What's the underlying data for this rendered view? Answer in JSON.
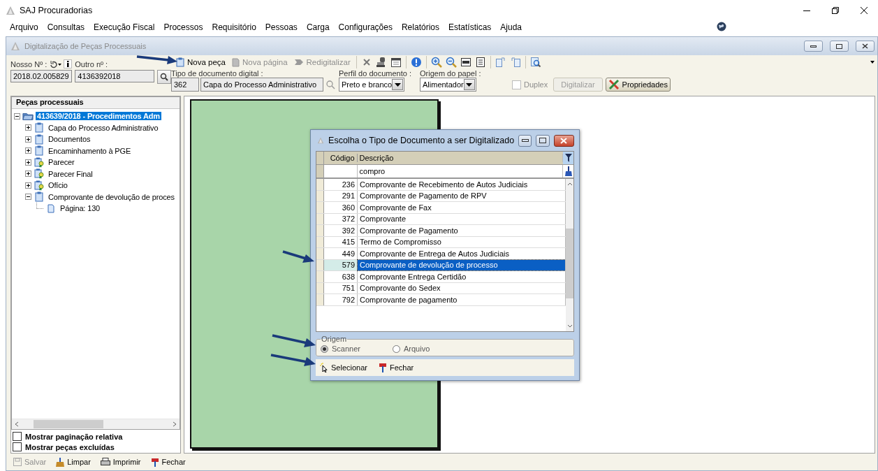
{
  "app_title": "SAJ Procuradorias",
  "menu": [
    "Arquivo",
    "Consultas",
    "Execução Fiscal",
    "Processos",
    "Requisitório",
    "Pessoas",
    "Carga",
    "Configurações",
    "Relatórios",
    "Estatísticas",
    "Ajuda"
  ],
  "window": {
    "title": "Digitalização de Peças Processuais"
  },
  "nosso_numero": {
    "label": "Nosso Nº :",
    "value": "2018.02.005829"
  },
  "outro_numero": {
    "label": "Outro nº :",
    "value": "4136392018"
  },
  "toolbar": [
    {
      "label": "Nova peça",
      "disabled": false
    },
    {
      "label": "Nova página",
      "disabled": true
    },
    {
      "label": "Redigitalizar",
      "disabled": true
    }
  ],
  "tipo_documento": {
    "label": "Tipo de documento digital :",
    "code": "362",
    "value": "Capa do Processo Administrativo"
  },
  "perfil": {
    "label": "Perfil do documento :",
    "value": "Preto e branco"
  },
  "origem_papel": {
    "label": "Origem do papel :",
    "value": "Alimentador"
  },
  "duplex": {
    "label": "Duplex",
    "checked": false,
    "disabled": true
  },
  "digitalizar": {
    "label": "Digitalizar",
    "disabled": true
  },
  "propriedades": {
    "label": "Propriedades"
  },
  "tree": {
    "title": "Peças processuais",
    "items": [
      {
        "label": "413639/2018 - Procedimentos Adm",
        "kind": "process",
        "selected": true,
        "expanded": true,
        "children": [
          {
            "label": "Capa do Processo Administrativo",
            "kind": "document",
            "selected": false,
            "expanded": false
          },
          {
            "label": "Documentos",
            "kind": "document",
            "selected": false,
            "expanded": false
          },
          {
            "label": "Encaminhamento à PGE",
            "kind": "document",
            "selected": false,
            "expanded": false
          },
          {
            "label": "Parecer",
            "kind": "signed",
            "selected": false,
            "expanded": false
          },
          {
            "label": "Parecer Final",
            "kind": "signed",
            "selected": false,
            "expanded": false
          },
          {
            "label": "Ofício",
            "kind": "signed",
            "selected": false,
            "expanded": false
          },
          {
            "label": "Comprovante de devolução de proces",
            "kind": "document",
            "selected": false,
            "expanded": true,
            "children": [
              {
                "label": "Página: 130",
                "kind": "page",
                "selected": false
              }
            ]
          }
        ]
      }
    ]
  },
  "options": [
    {
      "label": "Mostrar paginação relativa",
      "checked": false
    },
    {
      "label": "Mostrar peças excluídas",
      "checked": false
    }
  ],
  "bottom_buttons": [
    {
      "label": "Salvar",
      "kind": "save",
      "disabled": true
    },
    {
      "label": "Limpar",
      "kind": "clear",
      "disabled": false
    },
    {
      "label": "Imprimir",
      "kind": "print",
      "disabled": false
    },
    {
      "label": "Fechar",
      "kind": "close",
      "disabled": false
    }
  ],
  "dialog": {
    "title": "Escolha o Tipo de Documento a ser Digitalizado",
    "columns": [
      "Código",
      "Descrição"
    ],
    "filter": "compro",
    "rows": [
      {
        "code": "236",
        "description": "Comprovante de Recebimento de Autos Judiciais",
        "selected": false
      },
      {
        "code": "291",
        "description": "Comprovante de Pagamento de RPV",
        "selected": false
      },
      {
        "code": "360",
        "description": "Comprovante de Fax",
        "selected": false
      },
      {
        "code": "372",
        "description": "Comprovante",
        "selected": false
      },
      {
        "code": "392",
        "description": "Comprovante de Pagamento",
        "selected": false
      },
      {
        "code": "415",
        "description": "Termo de Compromisso",
        "selected": false
      },
      {
        "code": "449",
        "description": "Comprovante de Entrega de Autos Judiciais",
        "selected": false
      },
      {
        "code": "579",
        "description": "Comprovante de devolução de processo",
        "selected": true
      },
      {
        "code": "638",
        "description": "Comprovante Entrega Certidão",
        "selected": false
      },
      {
        "code": "751",
        "description": "Comprovante do Sedex",
        "selected": false
      },
      {
        "code": "792",
        "description": "Comprovante de pagamento",
        "selected": false
      }
    ],
    "origem": {
      "label": "Origem",
      "options": [
        {
          "label": "Scanner",
          "selected": true
        },
        {
          "label": "Arquivo",
          "selected": false
        }
      ]
    },
    "buttons": [
      {
        "label": "Selecionar",
        "kind": "select"
      },
      {
        "label": "Fechar",
        "kind": "close"
      }
    ]
  }
}
